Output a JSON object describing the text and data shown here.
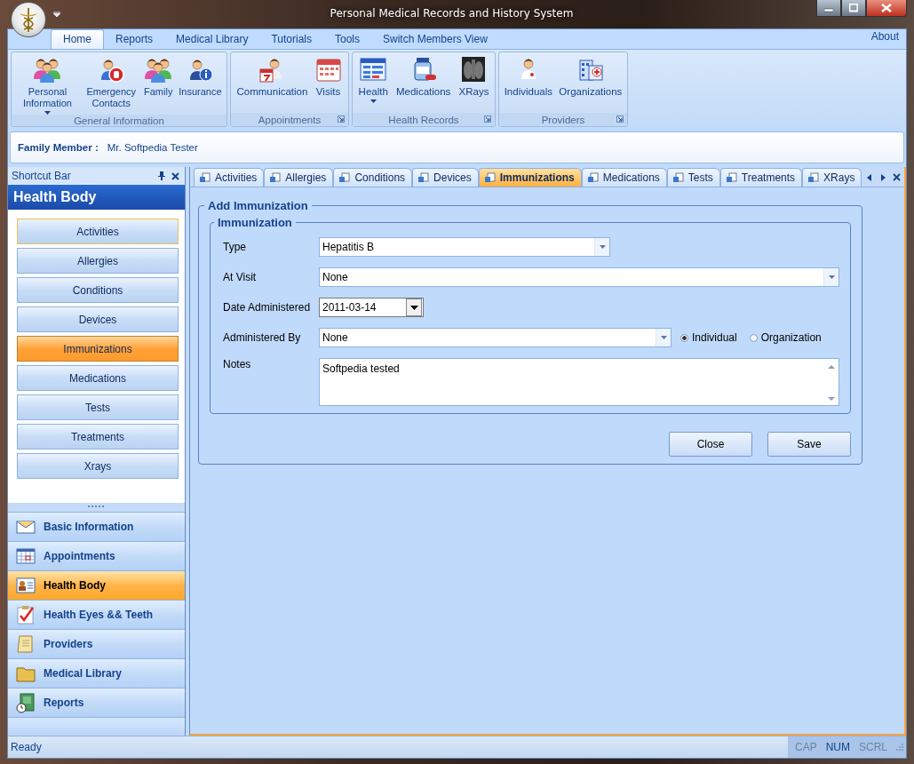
{
  "window": {
    "title": "Personal Medical Records and History System"
  },
  "ribbon": {
    "tabs": [
      {
        "label": "Home",
        "selected": true
      },
      {
        "label": "Reports",
        "selected": false
      },
      {
        "label": "Medical Library",
        "selected": false
      },
      {
        "label": "Tutorials",
        "selected": false
      },
      {
        "label": "Tools",
        "selected": false
      },
      {
        "label": "Switch Members View",
        "selected": false
      }
    ],
    "about": "About",
    "groups": [
      {
        "label": "General  Information",
        "launcher": false,
        "buttons": [
          {
            "label": "Personal Information",
            "dropdown": true
          },
          {
            "label": "Emergency Contacts",
            "dropdown": false
          },
          {
            "label": "Family",
            "dropdown": false
          },
          {
            "label": "Insurance",
            "dropdown": false
          }
        ]
      },
      {
        "label": "Appointments",
        "launcher": true,
        "buttons": [
          {
            "label": "Communication",
            "dropdown": false
          },
          {
            "label": "Visits",
            "dropdown": false
          }
        ]
      },
      {
        "label": "Health Records",
        "launcher": true,
        "buttons": [
          {
            "label": "Health",
            "dropdown": true
          },
          {
            "label": "Medications",
            "dropdown": false
          },
          {
            "label": "XRays",
            "dropdown": false
          }
        ]
      },
      {
        "label": "Providers",
        "launcher": true,
        "buttons": [
          {
            "label": "Individuals",
            "dropdown": false
          },
          {
            "label": "Organizations",
            "dropdown": false
          }
        ]
      }
    ]
  },
  "family_member": {
    "label": "Family Member :",
    "value": "Mr. Softpedia Tester"
  },
  "shortcut_bar": {
    "title": "Shortcut Bar",
    "section": "Health Body",
    "items": [
      {
        "label": "Activities",
        "selected": false,
        "focused": true
      },
      {
        "label": "Allergies",
        "selected": false,
        "focused": false
      },
      {
        "label": "Conditions",
        "selected": false,
        "focused": false
      },
      {
        "label": "Devices",
        "selected": false,
        "focused": false
      },
      {
        "label": "Immunizations",
        "selected": true,
        "focused": false
      },
      {
        "label": "Medications",
        "selected": false,
        "focused": false
      },
      {
        "label": "Tests",
        "selected": false,
        "focused": false
      },
      {
        "label": "Treatments",
        "selected": false,
        "focused": false
      },
      {
        "label": "Xrays",
        "selected": false,
        "focused": false
      }
    ],
    "navigation": [
      {
        "label": "Basic Information",
        "selected": false
      },
      {
        "label": "Appointments",
        "selected": false
      },
      {
        "label": "Health Body",
        "selected": true
      },
      {
        "label": "Health Eyes && Teeth",
        "selected": false
      },
      {
        "label": "Providers",
        "selected": false
      },
      {
        "label": "Medical Library",
        "selected": false
      },
      {
        "label": "Reports",
        "selected": false
      }
    ]
  },
  "tabs": [
    {
      "label": "Activities",
      "selected": false
    },
    {
      "label": "Allergies",
      "selected": false
    },
    {
      "label": "Conditions",
      "selected": false
    },
    {
      "label": "Devices",
      "selected": false
    },
    {
      "label": "Immunizations",
      "selected": true
    },
    {
      "label": "Medications",
      "selected": false
    },
    {
      "label": "Tests",
      "selected": false
    },
    {
      "label": "Treatments",
      "selected": false
    },
    {
      "label": "XRays",
      "selected": false
    }
  ],
  "form": {
    "title": "Add Immunization",
    "group": "Immunization",
    "fields": [
      {
        "kind": "combo",
        "label": "Type",
        "value": "Hepatitis B"
      },
      {
        "kind": "combo",
        "label": "At Visit",
        "value": "None"
      },
      {
        "kind": "date",
        "label": "Date Administered",
        "value": "2011-03-14"
      },
      {
        "kind": "combo",
        "label": "Administered By",
        "value": "None",
        "options": [
          {
            "label": "Individual",
            "selected": true
          },
          {
            "label": "Organization",
            "selected": false
          }
        ]
      },
      {
        "kind": "memo",
        "label": "Notes",
        "value": "Softpedia tested"
      }
    ],
    "buttons": [
      "Close",
      "Save"
    ]
  },
  "status_bar": {
    "text": "Ready",
    "indicators": [
      {
        "label": "CAP",
        "on": false
      },
      {
        "label": "NUM",
        "on": true
      },
      {
        "label": "SCRL",
        "on": false
      }
    ]
  }
}
